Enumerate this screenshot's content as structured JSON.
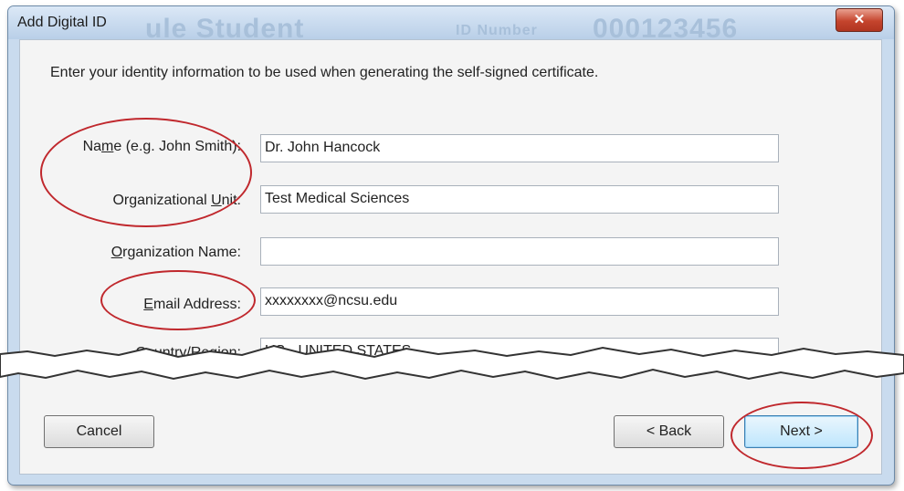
{
  "dialog": {
    "title": "Add Digital ID",
    "close_symbol": "✕",
    "ghost_text": {
      "name": "ule Student",
      "id_label": "ID Number",
      "id_value": "000123456"
    }
  },
  "form": {
    "instruction": "Enter your identity information to be used when generating the self-signed certificate.",
    "fields": {
      "name": {
        "label_pre": "Na",
        "label_u": "m",
        "label_post": "e (e.g. John Smith):",
        "value": "Dr. John Hancock"
      },
      "org_unit": {
        "label_pre": "Organizational ",
        "label_u": "U",
        "label_post": "nit:",
        "value": "Test Medical Sciences"
      },
      "org_name": {
        "label_pre": "",
        "label_u": "O",
        "label_post": "rganization Name:",
        "value": ""
      },
      "email": {
        "label_pre": "",
        "label_u": "E",
        "label_post": "mail Address:",
        "value": "xxxxxxxx@ncsu.edu"
      },
      "country": {
        "label": "Country/Region:",
        "value": "US - UNITED STATES"
      }
    }
  },
  "buttons": {
    "cancel": "Cancel",
    "back": "< Back",
    "next": "Next >"
  },
  "colors": {
    "callout": "#c0282d"
  }
}
